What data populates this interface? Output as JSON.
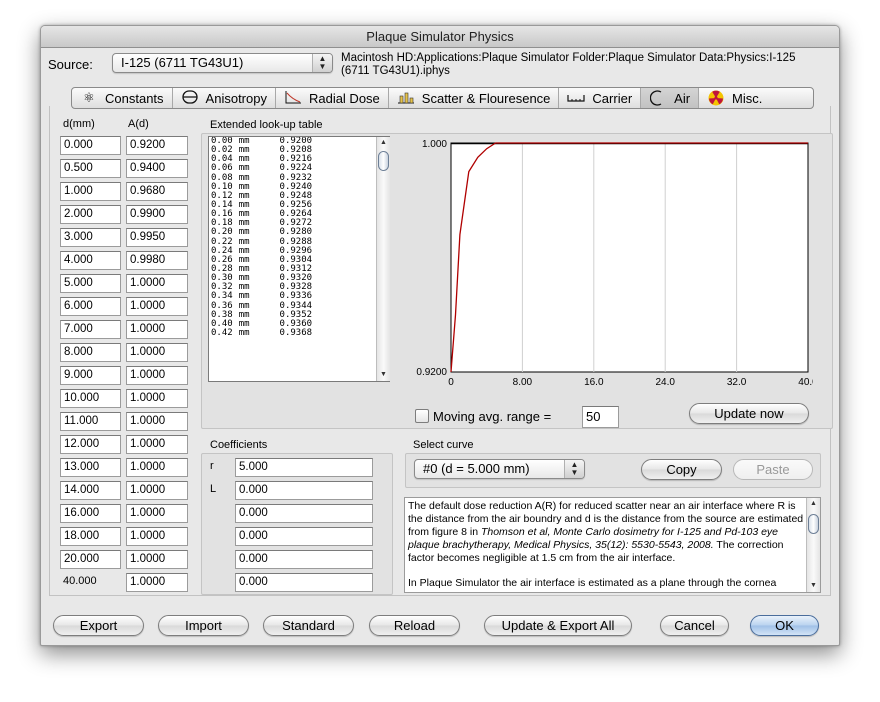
{
  "window": {
    "title": "Plaque Simulator Physics"
  },
  "source": {
    "label": "Source:",
    "selected": "I-125 (6711 TG43U1)",
    "path_line1": "Macintosh HD:Applications:Plaque Simulator Folder:Plaque Simulator Data:Physics:I-125",
    "path_line2": "(6711 TG43U1).iphys"
  },
  "tabs": [
    {
      "label": "Constants",
      "icon": "atom-icon"
    },
    {
      "label": "Anisotropy",
      "icon": "seed-icon"
    },
    {
      "label": "Radial Dose",
      "icon": "radial-dose-icon"
    },
    {
      "label": "Scatter & Flouresence",
      "icon": "scatter-icon"
    },
    {
      "label": "Carrier",
      "icon": "carrier-icon"
    },
    {
      "label": "Air",
      "icon": "air-icon"
    },
    {
      "label": "Misc.",
      "icon": "radiation-icon"
    }
  ],
  "table": {
    "header_d": "d(mm)",
    "header_a": "A(d)",
    "rows": [
      {
        "d": "0.000",
        "a": "0.9200"
      },
      {
        "d": "0.500",
        "a": "0.9400"
      },
      {
        "d": "1.000",
        "a": "0.9680"
      },
      {
        "d": "2.000",
        "a": "0.9900"
      },
      {
        "d": "3.000",
        "a": "0.9950"
      },
      {
        "d": "4.000",
        "a": "0.9980"
      },
      {
        "d": "5.000",
        "a": "1.0000"
      },
      {
        "d": "6.000",
        "a": "1.0000"
      },
      {
        "d": "7.000",
        "a": "1.0000"
      },
      {
        "d": "8.000",
        "a": "1.0000"
      },
      {
        "d": "9.000",
        "a": "1.0000"
      },
      {
        "d": "10.000",
        "a": "1.0000"
      },
      {
        "d": "11.000",
        "a": "1.0000"
      },
      {
        "d": "12.000",
        "a": "1.0000"
      },
      {
        "d": "13.000",
        "a": "1.0000"
      },
      {
        "d": "14.000",
        "a": "1.0000"
      },
      {
        "d": "16.000",
        "a": "1.0000"
      },
      {
        "d": "18.000",
        "a": "1.0000"
      },
      {
        "d": "20.000",
        "a": "1.0000"
      },
      {
        "d": "40.000",
        "a": "1.0000"
      }
    ]
  },
  "lookup": {
    "title": "Extended look-up table",
    "unit": "mm",
    "rows": [
      {
        "d": "0.00",
        "v": "0.9200"
      },
      {
        "d": "0.02",
        "v": "0.9208"
      },
      {
        "d": "0.04",
        "v": "0.9216"
      },
      {
        "d": "0.06",
        "v": "0.9224"
      },
      {
        "d": "0.08",
        "v": "0.9232"
      },
      {
        "d": "0.10",
        "v": "0.9240"
      },
      {
        "d": "0.12",
        "v": "0.9248"
      },
      {
        "d": "0.14",
        "v": "0.9256"
      },
      {
        "d": "0.16",
        "v": "0.9264"
      },
      {
        "d": "0.18",
        "v": "0.9272"
      },
      {
        "d": "0.20",
        "v": "0.9280"
      },
      {
        "d": "0.22",
        "v": "0.9288"
      },
      {
        "d": "0.24",
        "v": "0.9296"
      },
      {
        "d": "0.26",
        "v": "0.9304"
      },
      {
        "d": "0.28",
        "v": "0.9312"
      },
      {
        "d": "0.30",
        "v": "0.9320"
      },
      {
        "d": "0.32",
        "v": "0.9328"
      },
      {
        "d": "0.34",
        "v": "0.9336"
      },
      {
        "d": "0.36",
        "v": "0.9344"
      },
      {
        "d": "0.38",
        "v": "0.9352"
      },
      {
        "d": "0.40",
        "v": "0.9360"
      },
      {
        "d": "0.42",
        "v": "0.9368"
      }
    ]
  },
  "chart_data": {
    "type": "line",
    "x": [
      0,
      0.5,
      1,
      2,
      3,
      4,
      5,
      40
    ],
    "y": [
      0.92,
      0.94,
      0.968,
      0.99,
      0.995,
      0.998,
      1.0,
      1.0
    ],
    "xlim": [
      0,
      40
    ],
    "ylim": [
      0.92,
      1.0
    ],
    "xticks": [
      "0",
      "8.00",
      "16.0",
      "24.0",
      "32.0",
      "40.0"
    ],
    "xtick_values": [
      0,
      8,
      16,
      24,
      32,
      40
    ],
    "ymax_label": "1.000",
    "ymin_label": "0.9200",
    "grid": true,
    "line_color": "#b00000"
  },
  "moving_avg": {
    "label": "Moving avg. range =",
    "value": "50"
  },
  "buttons": {
    "update_now": "Update now",
    "copy": "Copy",
    "paste": "Paste",
    "export": "Export",
    "import": "Import",
    "standard": "Standard",
    "reload": "Reload",
    "update_export_all": "Update & Export All",
    "cancel": "Cancel",
    "ok": "OK"
  },
  "coefficients": {
    "title": "Coefficients",
    "rows": [
      {
        "label": "r",
        "value": "5.000"
      },
      {
        "label": "L",
        "value": "0.000"
      },
      {
        "label": "",
        "value": "0.000"
      },
      {
        "label": "",
        "value": "0.000"
      },
      {
        "label": "",
        "value": "0.000"
      },
      {
        "label": "",
        "value": "0.000"
      }
    ]
  },
  "select_curve": {
    "title": "Select curve",
    "selected": "#0 (d = 5.000 mm)"
  },
  "description": {
    "p1a": "The default dose reduction A(R) for reduced scatter near an air interface  where R is the distance from the air boundry and d is the distance from the source are estimated from figure 8 in ",
    "p1_italic": "Thomson et al, Monte Carlo dosimetry for I-125 and Pd-103 eye plaque brachytherapy, Medical Physics, 35(12): 5530-5543, 2008.",
    "p1b": " The correction factor becomes negligible at 1.5 cm from the air interface.",
    "p2": "In Plaque Simulator the air interface is estimated as a plane through the cornea"
  }
}
